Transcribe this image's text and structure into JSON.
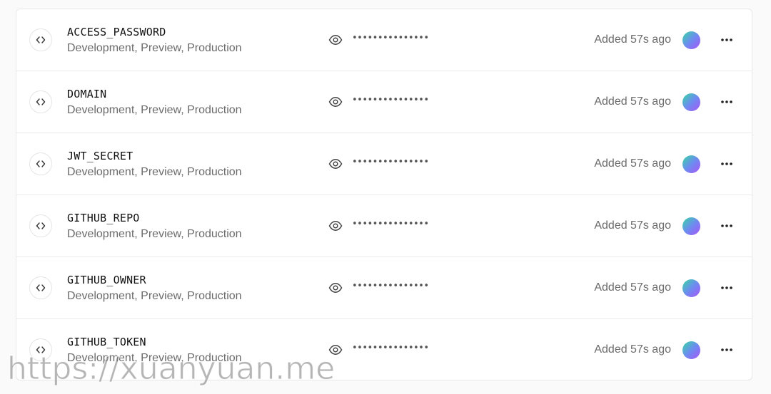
{
  "variables": [
    {
      "name": "ACCESS_PASSWORD",
      "environments": "Development, Preview, Production",
      "masked_value": "•••••••••••••••",
      "added": "Added 57s ago"
    },
    {
      "name": "DOMAIN",
      "environments": "Development, Preview, Production",
      "masked_value": "•••••••••••••••",
      "added": "Added 57s ago"
    },
    {
      "name": "JWT_SECRET",
      "environments": "Development, Preview, Production",
      "masked_value": "•••••••••••••••",
      "added": "Added 57s ago"
    },
    {
      "name": "GITHUB_REPO",
      "environments": "Development, Preview, Production",
      "masked_value": "•••••••••••••••",
      "added": "Added 57s ago"
    },
    {
      "name": "GITHUB_OWNER",
      "environments": "Development, Preview, Production",
      "masked_value": "•••••••••••••••",
      "added": "Added 57s ago"
    },
    {
      "name": "GITHUB_TOKEN",
      "environments": "Development, Preview, Production",
      "masked_value": "•••••••••••••••",
      "added": "Added 57s ago"
    }
  ],
  "icons": {
    "row_icon": "code-brackets-icon",
    "reveal": "eye-icon",
    "menu": "more-horizontal-icon"
  },
  "watermark": "https://xuanyuan.me",
  "colors": {
    "avatar_gradient_start": "#34d9a0",
    "avatar_gradient_mid": "#6d8cf0",
    "avatar_gradient_end": "#a855f7"
  }
}
